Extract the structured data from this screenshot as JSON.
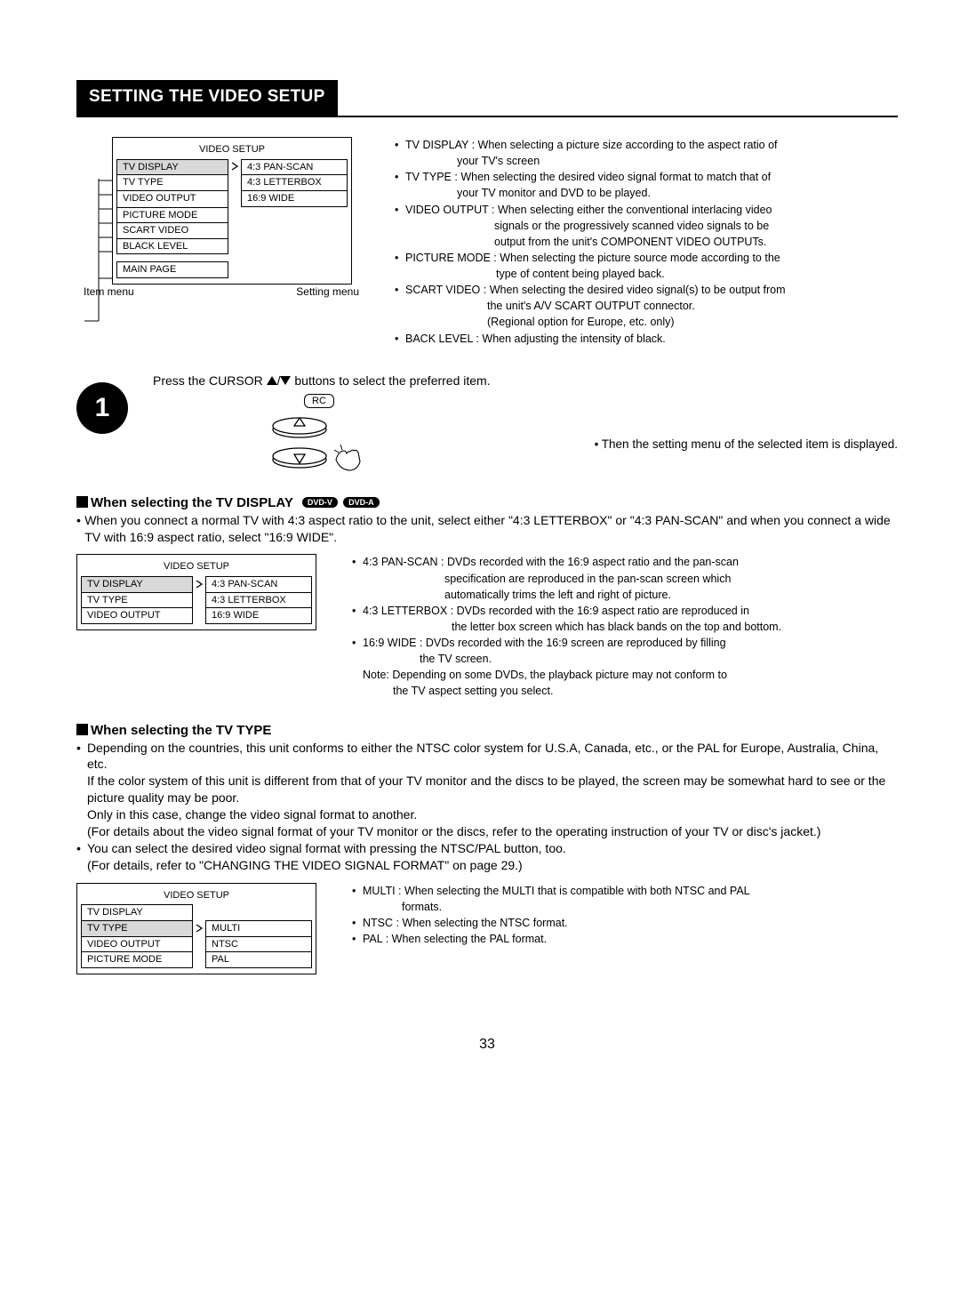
{
  "title": "SETTING THE VIDEO SETUP",
  "page_number": "33",
  "menu_header": "VIDEO SETUP",
  "item_menu_label": "Item menu",
  "setting_menu_label": "Setting menu",
  "menuA_left": [
    "TV DISPLAY",
    "TV TYPE",
    "VIDEO OUTPUT",
    "PICTURE MODE",
    "SCART VIDEO",
    "BLACK LEVEL"
  ],
  "menuA_main": "MAIN PAGE",
  "menuA_right": [
    "4:3 PAN-SCAN",
    "4:3 LETTERBOX",
    "16:9 WIDE"
  ],
  "descA": [
    {
      "head": "TV DISPLAY :",
      "body": "When selecting a picture size according to the aspect ratio of",
      "cont": "your TV's screen"
    },
    {
      "head": "TV TYPE :",
      "body": "When selecting the desired video signal format to match that of",
      "cont": "your TV monitor and DVD to be played."
    },
    {
      "head": "VIDEO OUTPUT :",
      "body": "When selecting either the conventional interlacing video",
      "cont": "signals or the progressively scanned video signals to be",
      "cont2": "output from the unit's COMPONENT VIDEO OUTPUTs."
    },
    {
      "head": "PICTURE MODE :",
      "body": "When selecting the picture source mode according to the",
      "cont": "type of content being played back."
    },
    {
      "head": "SCART VIDEO :",
      "body": "When selecting the desired video signal(s) to be output from",
      "cont": "the unit's A/V SCART OUTPUT connector.",
      "cont2": "(Regional option for Europe, etc. only)"
    },
    {
      "head": "BACK LEVEL :",
      "body": "When adjusting the intensity of black."
    }
  ],
  "step1_pre": "Press the CURSOR ",
  "step1_post": " buttons to select the preferred item.",
  "rc_label": "RC",
  "step1_result_bullet": "• Then the setting menu of the selected item is displayed.",
  "step_badge": "1",
  "sec1_title": "When selecting the TV DISPLAY",
  "pill_dvdv": "DVD-V",
  "pill_dvda": "DVD-A",
  "sec1_bullet": "When you connect a normal TV with 4:3 aspect ratio to the unit, select either \"4:3 LETTERBOX\" or \"4:3 PAN-SCAN\" and when you connect a wide TV with 16:9 aspect ratio, select \"16:9 WIDE\".",
  "menuB_left": [
    "TV DISPLAY",
    "TV TYPE",
    "VIDEO OUTPUT"
  ],
  "menuB_right": [
    "4:3 PAN-SCAN",
    "4:3 LETTERBOX",
    "16:9 WIDE"
  ],
  "descB": [
    {
      "head": "4:3 PAN-SCAN :",
      "body": "DVDs recorded with the 16:9 aspect ratio and the pan-scan",
      "cont": "specification are reproduced in the pan-scan screen which",
      "cont2": "automatically trims the left and right of picture."
    },
    {
      "head": "4:3 LETTERBOX :",
      "body": "DVDs recorded with the 16:9 aspect ratio are reproduced in",
      "cont": "the letter box screen which has black bands on the top and bottom."
    },
    {
      "head": "16:9 WIDE :",
      "body": "DVDs recorded with the 16:9 screen are reproduced by filling",
      "cont": "the TV screen."
    }
  ],
  "descB_note1": "Note: Depending on some DVDs, the playback picture may not conform to",
  "descB_note2": "the TV aspect setting you select.",
  "sec2_title": "When selecting the TV TYPE",
  "sec2_b1": "Depending on the countries, this unit conforms to either the NTSC color system for U.S.A, Canada, etc., or the PAL for Europe, Australia, China, etc.",
  "sec2_b1b": "If the color system of this unit is different from that of your TV monitor and the discs to be played, the screen may be somewhat hard to see or the picture quality may be poor.",
  "sec2_b1c": "Only in this case, change the video signal format to another.",
  "sec2_b1d": "(For details about the video signal format of your TV monitor or the discs, refer to the operating instruction of your TV or disc's jacket.)",
  "sec2_b2": "You can select the desired video signal format with pressing the NTSC/PAL button, too.",
  "sec2_b2b": "(For details, refer to \"CHANGING THE VIDEO SIGNAL FORMAT\" on page 29.)",
  "menuC_left": [
    "TV DISPLAY",
    "TV TYPE",
    "VIDEO OUTPUT",
    "PICTURE MODE"
  ],
  "menuC_right": [
    "MULTI",
    "NTSC",
    "PAL"
  ],
  "descC": [
    {
      "head": "MULTI :",
      "body": "When selecting the MULTI that is compatible with both NTSC and PAL",
      "cont": "formats."
    },
    {
      "head": "NTSC :",
      "body": "When selecting the NTSC format."
    },
    {
      "head": "PAL :",
      "body": "When selecting the PAL format."
    }
  ]
}
